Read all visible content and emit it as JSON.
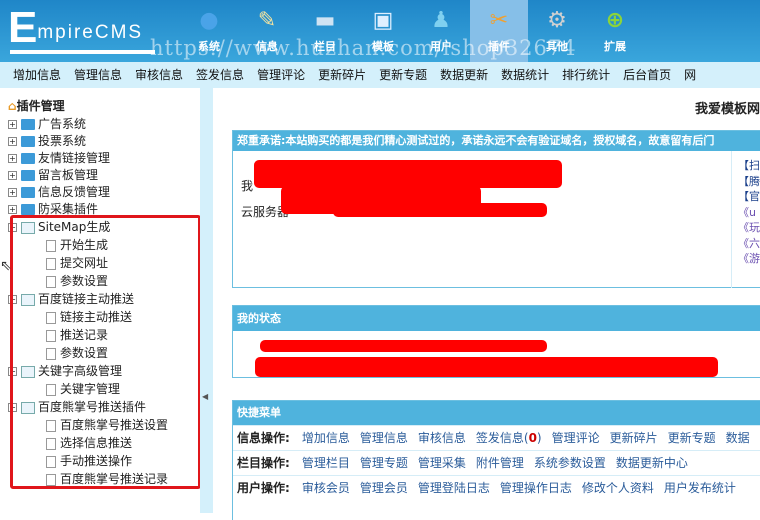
{
  "header": {
    "logo": {
      "first": "E",
      "rest": "mpireCMS"
    },
    "nav": [
      {
        "label": "系统",
        "icon": "globe-icon"
      },
      {
        "label": "信息",
        "icon": "document-pencil-icon"
      },
      {
        "label": "栏目",
        "icon": "folder-icon"
      },
      {
        "label": "模板",
        "icon": "window-icon"
      },
      {
        "label": "用户",
        "icon": "user-icon"
      },
      {
        "label": "插件",
        "icon": "tools-icon",
        "active": true
      },
      {
        "label": "其他",
        "icon": "gear-icon"
      },
      {
        "label": "扩展",
        "icon": "plus-icon"
      }
    ],
    "watermark": "https://www.huzhan.com/ishop32674"
  },
  "subnav": [
    "增加信息",
    "管理信息",
    "审核信息",
    "签发信息",
    "管理评论",
    "更新碎片",
    "更新专题",
    "数据更新",
    "数据统计",
    "排行统计",
    "后台首页",
    "网"
  ],
  "sidebar": {
    "title": "插件管理",
    "folders": [
      "广告系统",
      "投票系统",
      "友情链接管理",
      "留言板管理",
      "信息反馈管理",
      "防采集插件"
    ],
    "groups": [
      {
        "label": "SiteMap生成",
        "children": [
          "开始生成",
          "提交网址",
          "参数设置"
        ]
      },
      {
        "label": "百度链接主动推送",
        "children": [
          "链接主动推送",
          "推送记录",
          "参数设置"
        ]
      },
      {
        "label": "关键字高级管理",
        "children": [
          "关键字管理"
        ]
      },
      {
        "label": "百度熊掌号推送插件",
        "children": [
          "百度熊掌号推送设置",
          "选择信息推送",
          "手动推送操作",
          "百度熊掌号推送记录"
        ]
      }
    ]
  },
  "main": {
    "site_title": "我爱模板网",
    "notice": {
      "header": "郑重承诺:本站购买的都是我们精心测试过的，承诺永远不会有验证域名，授权域名，故意留有后门",
      "line1_prefix": "我",
      "line2_prefix": "云服务器",
      "links": [
        "【扫",
        "【腾",
        "【官",
        "《u",
        "《玩",
        "《六",
        "《游"
      ]
    },
    "status": {
      "header": "我的状态"
    },
    "quick": {
      "header": "快捷菜单",
      "rows": [
        {
          "label": "信息操作:",
          "items": [
            "增加信息",
            "管理信息",
            "审核信息",
            "签发信息",
            "管理评论",
            "更新碎片",
            "更新专题",
            "数据"
          ],
          "count": "0"
        },
        {
          "label": "栏目操作:",
          "items": [
            "管理栏目",
            "管理专题",
            "管理采集",
            "附件管理",
            "系统参数设置",
            "数据更新中心"
          ]
        },
        {
          "label": "用户操作:",
          "items": [
            "审核会员",
            "管理会员",
            "管理登陆日志",
            "管理操作日志",
            "修改个人资料",
            "用户发布统计"
          ]
        }
      ]
    }
  },
  "colors": {
    "header_blue": "#2d96d4",
    "panel_header": "#4fb3dd",
    "highlight_red": "#e0161b"
  }
}
